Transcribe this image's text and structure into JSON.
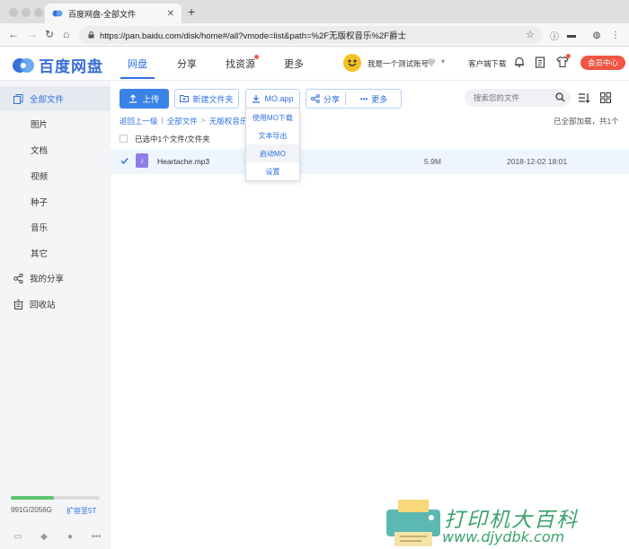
{
  "browser": {
    "tab_title": "百度网盘-全部文件",
    "url": "https://pan.baidu.com/disk/home#/all?vmode=list&path=%2F无版权音乐%2F爵士"
  },
  "header": {
    "logo_text": "百度网盘",
    "nav": [
      "网盘",
      "分享",
      "找资源",
      "更多"
    ],
    "username": "我是一个测试账号",
    "client_download": "客户端下载",
    "member_center": "会员中心"
  },
  "sidebar": {
    "items": [
      {
        "label": "全部文件",
        "icon": "files-icon",
        "active": true
      },
      {
        "label": "图片"
      },
      {
        "label": "文档"
      },
      {
        "label": "视频"
      },
      {
        "label": "种子"
      },
      {
        "label": "音乐"
      },
      {
        "label": "其它"
      },
      {
        "label": "我的分享",
        "icon": "share-icon"
      },
      {
        "label": "回收站",
        "icon": "trash-icon"
      }
    ],
    "quota_text": "991G/2056G",
    "quota_fraction": 0.48,
    "expand_label": "扩容至5T"
  },
  "toolbar": {
    "upload": "上传",
    "new_folder": "新建文件夹",
    "mo_app": "MO.app",
    "share": "分享",
    "more": "更多",
    "search_placeholder": "搜索您的文件"
  },
  "breadcrumb": {
    "back": "返回上一级",
    "all": "全部文件",
    "folder": "无版权音乐",
    "current": "爵"
  },
  "loaded_status": "已全部加载，共1个",
  "selection_text": "已选中1个文件/文件夹",
  "files": [
    {
      "name": "Heartache.mp3",
      "size": "5.9M",
      "date": "2018-12-02 18:01",
      "selected": true
    }
  ],
  "dropdown": {
    "items": [
      "使用MO下载",
      "文本导出",
      "启动MO",
      "设置"
    ],
    "hovered_index": 2
  },
  "watermark": {
    "title": "打印机大百科",
    "url": "www.djydbk.com"
  },
  "colors": {
    "accent": "#2f6fe0",
    "upload_button": "#3b82e8",
    "member_button": "#f05444",
    "quota_fill": "#5cc470",
    "watermark": "#3aa36d"
  }
}
